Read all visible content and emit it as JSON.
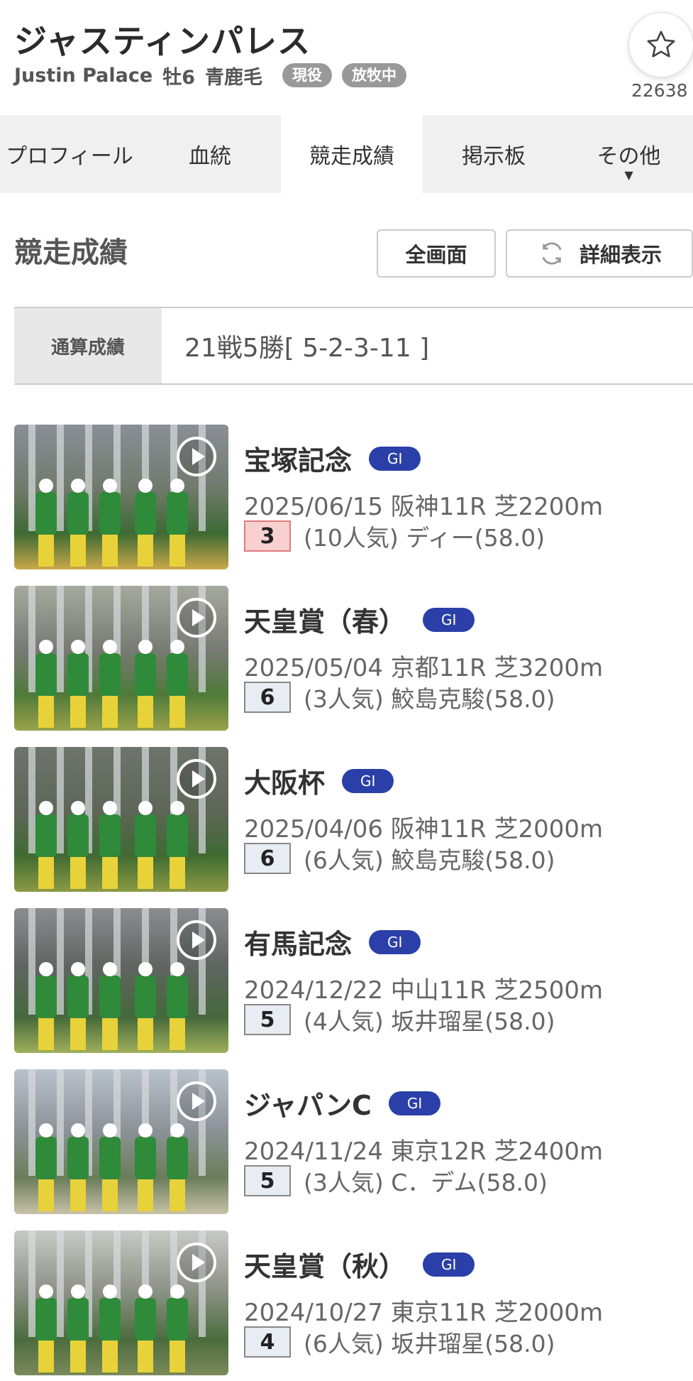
{
  "horse": {
    "name": "ジャスティンパレス",
    "name_en": "Justin Palace",
    "sex_age": "牡6",
    "coat": "青鹿毛",
    "status_badges": [
      "現役",
      "放牧中"
    ],
    "favorite_count": "22638"
  },
  "tabs": [
    {
      "label": "プロフィール"
    },
    {
      "label": "血統"
    },
    {
      "label": "競走成績",
      "active": true
    },
    {
      "label": "掲示板"
    },
    {
      "label": "その他"
    }
  ],
  "section": {
    "title": "競走成績",
    "fullscreen_label": "全画面",
    "detail_label": "詳細表示"
  },
  "summary": {
    "label": "通算成績",
    "value": "21戦5勝[ 5-2-3-11 ]"
  },
  "races": [
    {
      "name": "宝塚記念",
      "grade": "GI",
      "info": "2025/06/15 阪神11R 芝2200m",
      "rank": "3",
      "result": "(10人気) ディー(58.0)",
      "top3": true
    },
    {
      "name": "天皇賞（春）",
      "grade": "GI",
      "info": "2025/05/04 京都11R 芝3200m",
      "rank": "6",
      "result": "(3人気) 鮫島克駿(58.0)",
      "top3": false
    },
    {
      "name": "大阪杯",
      "grade": "GI",
      "info": "2025/04/06 阪神11R 芝2000m",
      "rank": "6",
      "result": "(6人気) 鮫島克駿(58.0)",
      "top3": false
    },
    {
      "name": "有馬記念",
      "grade": "GI",
      "info": "2024/12/22 中山11R 芝2500m",
      "rank": "5",
      "result": "(4人気) 坂井瑠星(58.0)",
      "top3": false
    },
    {
      "name": "ジャパンC",
      "grade": "GI",
      "info": "2024/11/24 東京12R 芝2400m",
      "rank": "5",
      "result": "(3人気) C．デム(58.0)",
      "top3": false
    },
    {
      "name": "天皇賞（秋）",
      "grade": "GI",
      "info": "2024/10/27 東京11R 芝2000m",
      "rank": "4",
      "result": "(6人気) 坂井瑠星(58.0)",
      "top3": false
    }
  ],
  "colors": {
    "grade_badge": "#2b3fa8",
    "top3_rank_bg": "#f9d0d0",
    "tab_bg": "#f0f0f0"
  }
}
